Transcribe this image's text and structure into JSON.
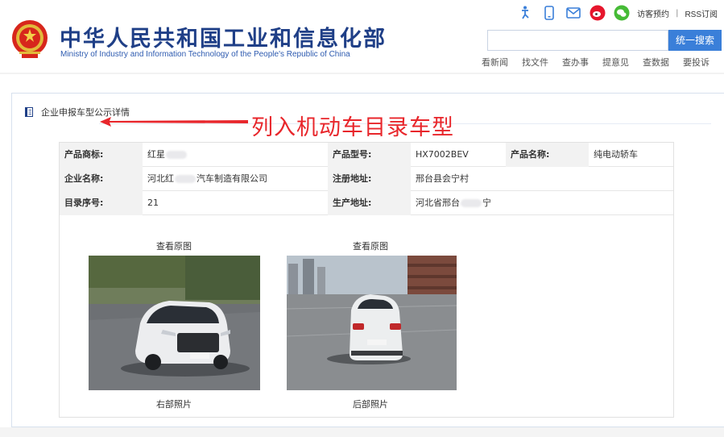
{
  "header": {
    "site_title": "中华人民共和国工业和信息化部",
    "site_subtitle": "Ministry of Industry and Information Technology of the People's Republic of China",
    "emblem_icon": "national-emblem-icon",
    "util_icons": [
      "accessibility-icon",
      "mobile-icon",
      "mail-icon",
      "weibo-icon",
      "wechat-icon"
    ],
    "util_visit": "访客预约",
    "util_sep": "|",
    "util_rss": "RSS订阅",
    "search_placeholder": "",
    "search_button": "统一搜索",
    "quick_links": [
      "看新闻",
      "找文件",
      "查办事",
      "提意见",
      "查数据",
      "要投诉"
    ],
    "brand_color": "#1f3f87",
    "accent_color": "#3a7fd9"
  },
  "panel": {
    "title": "企业申报车型公示详情",
    "icon": "book-icon"
  },
  "annotation": {
    "text": "列入机动车目录车型",
    "color": "#e8262b"
  },
  "detail": {
    "rows": [
      {
        "cells": [
          {
            "label": "产品商标:",
            "value": "红星"
          },
          {
            "label": "产品型号:",
            "value": "HX7002BEV"
          },
          {
            "label": "产品名称:",
            "value": "纯电动轿车"
          }
        ]
      },
      {
        "cells": [
          {
            "label": "企业名称:",
            "value_a": "河北红",
            "value_b": "汽车制造有限公司"
          },
          {
            "label": "注册地址:",
            "value": "邢台县会宁村"
          }
        ]
      },
      {
        "cells": [
          {
            "label": "目录序号:",
            "value": "21"
          },
          {
            "label": "生产地址:",
            "value_a": "河北省邢台",
            "value_b": "宁"
          }
        ]
      }
    ],
    "photos": [
      {
        "link": "查看原图",
        "caption": "右部照片",
        "alt": "white compact EV front-right view on wet road"
      },
      {
        "link": "查看原图",
        "caption": "后部照片",
        "alt": "white compact EV rear view in parking lot"
      }
    ]
  }
}
